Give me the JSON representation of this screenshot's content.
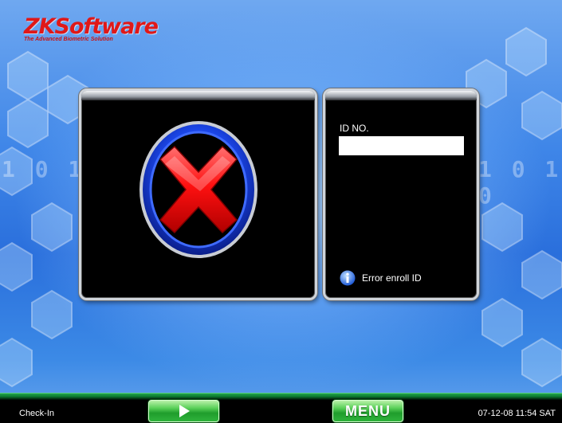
{
  "brand": {
    "name": "ZKSoftware",
    "tagline": "The Advanced Biometric Solution"
  },
  "background_binary": {
    "left": "1 0 1 0",
    "right": "1 0 1 0"
  },
  "left_panel": {
    "icon": "red-x-error-icon"
  },
  "right_panel": {
    "id_label": "ID NO.",
    "id_value": "",
    "status_icon": "info-icon",
    "status_text": "Error enroll ID"
  },
  "bottom_bar": {
    "mode": "Check-In",
    "play_icon": "play-icon",
    "menu_label": "MENU",
    "datetime": "07-12-08 11:54  SAT"
  },
  "colors": {
    "error_red": "#e01818",
    "ring_blue": "#1e4cff",
    "button_green": "#2fb33c",
    "bar_green": "#22a34a"
  }
}
